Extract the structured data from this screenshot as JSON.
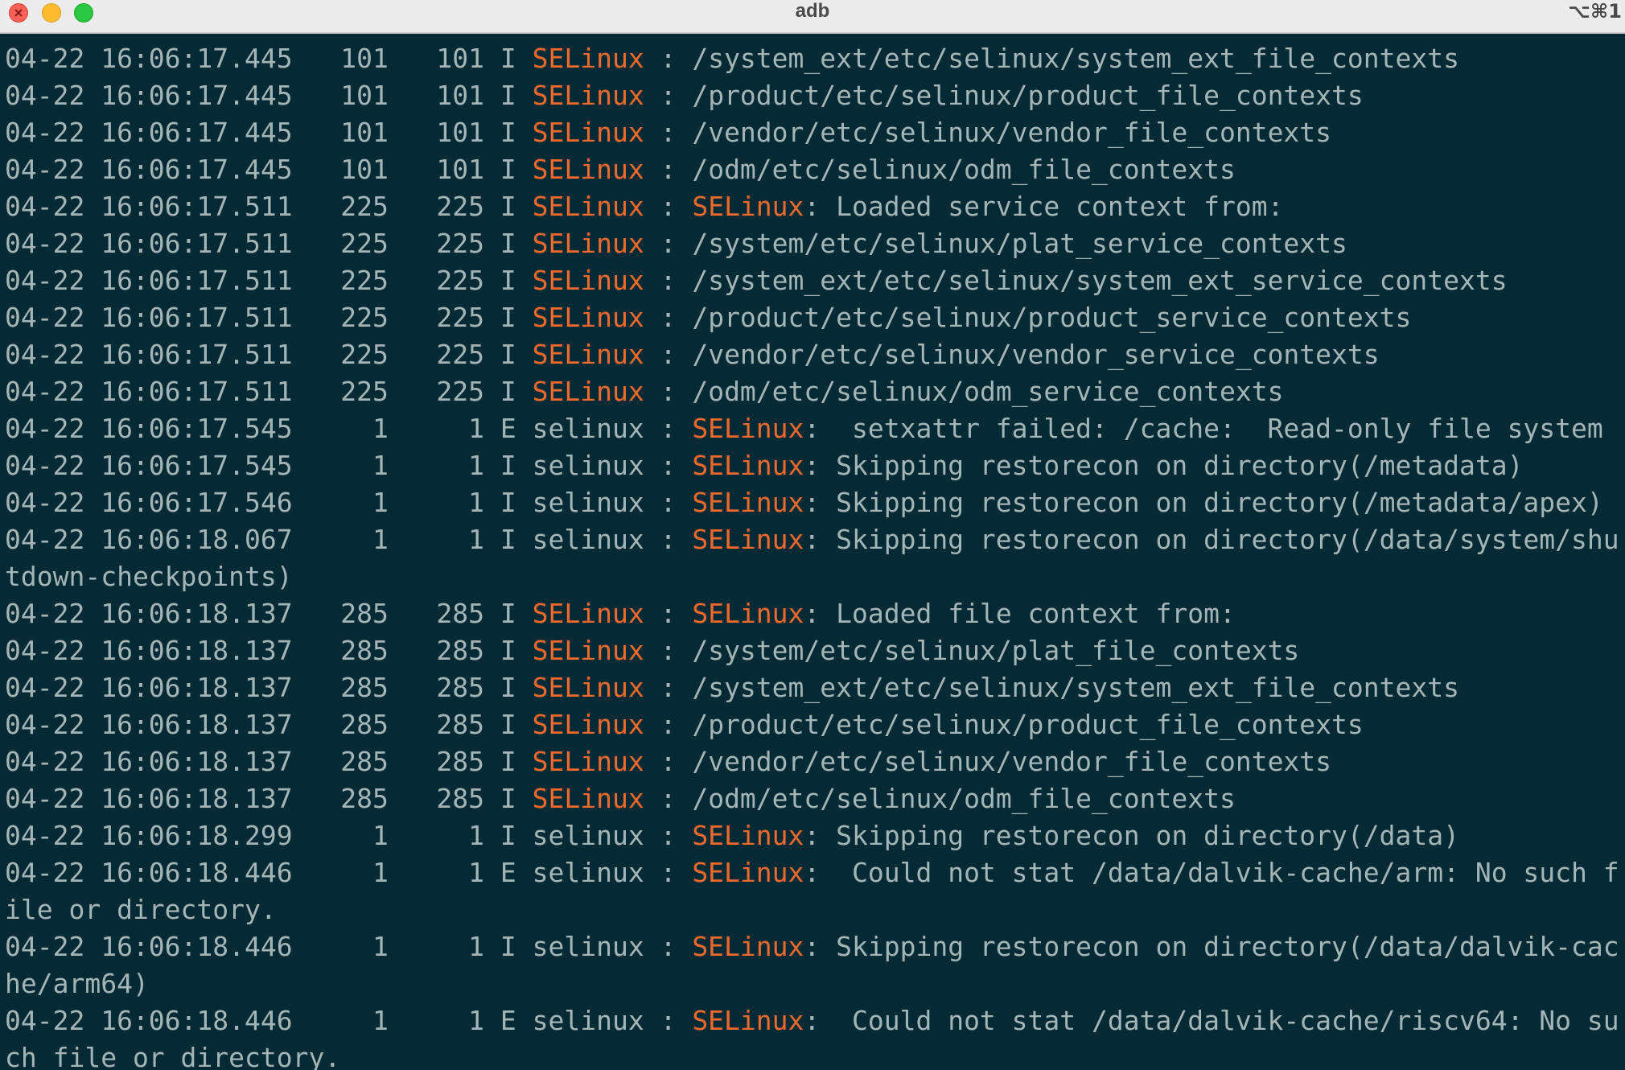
{
  "window": {
    "title": "adb",
    "shortcut": "⌥⌘1",
    "controls": {
      "close_glyph": "×"
    }
  },
  "colors": {
    "background": "#042b35",
    "text": "#a4b5b7",
    "highlight": "#ee6a2c",
    "titlebar": "#ececec"
  },
  "log_lines": [
    {
      "text": "04-22 16:06:17.445   101   101 I ",
      "tag": "SELinux",
      "rest_pre": " : ",
      "ctx": "",
      "rest": "/system_ext/etc/selinux/system_ext_file_contexts"
    },
    {
      "text": "04-22 16:06:17.445   101   101 I ",
      "tag": "SELinux",
      "rest_pre": " : ",
      "ctx": "",
      "rest": "/product/etc/selinux/product_file_contexts"
    },
    {
      "text": "04-22 16:06:17.445   101   101 I ",
      "tag": "SELinux",
      "rest_pre": " : ",
      "ctx": "",
      "rest": "/vendor/etc/selinux/vendor_file_contexts"
    },
    {
      "text": "04-22 16:06:17.445   101   101 I ",
      "tag": "SELinux",
      "rest_pre": " : ",
      "ctx": "",
      "rest": "/odm/etc/selinux/odm_file_contexts"
    },
    {
      "text": "04-22 16:06:17.511   225   225 I ",
      "tag": "SELinux",
      "rest_pre": " : ",
      "ctx": "SELinux",
      "rest": ": Loaded service context from:"
    },
    {
      "text": "04-22 16:06:17.511   225   225 I ",
      "tag": "SELinux",
      "rest_pre": " : ",
      "ctx": "",
      "rest": "/system/etc/selinux/plat_service_contexts"
    },
    {
      "text": "04-22 16:06:17.511   225   225 I ",
      "tag": "SELinux",
      "rest_pre": " : ",
      "ctx": "",
      "rest": "/system_ext/etc/selinux/system_ext_service_contexts"
    },
    {
      "text": "04-22 16:06:17.511   225   225 I ",
      "tag": "SELinux",
      "rest_pre": " : ",
      "ctx": "",
      "rest": "/product/etc/selinux/product_service_contexts"
    },
    {
      "text": "04-22 16:06:17.511   225   225 I ",
      "tag": "SELinux",
      "rest_pre": " : ",
      "ctx": "",
      "rest": "/vendor/etc/selinux/vendor_service_contexts"
    },
    {
      "text": "04-22 16:06:17.511   225   225 I ",
      "tag": "SELinux",
      "rest_pre": " : ",
      "ctx": "",
      "rest": "/odm/etc/selinux/odm_service_contexts"
    },
    {
      "text": "04-22 16:06:17.545     1     1 E selinux : ",
      "tag": "",
      "rest_pre": "",
      "ctx": "SELinux",
      "rest": ":  setxattr failed: /cache:  Read-only file system"
    },
    {
      "text": "04-22 16:06:17.545     1     1 I selinux : ",
      "tag": "",
      "rest_pre": "",
      "ctx": "SELinux",
      "rest": ": Skipping restorecon on directory(/metadata)"
    },
    {
      "text": "04-22 16:06:17.546     1     1 I selinux : ",
      "tag": "",
      "rest_pre": "",
      "ctx": "SELinux",
      "rest": ": Skipping restorecon on directory(/metadata/apex)"
    },
    {
      "text": "04-22 16:06:18.067     1     1 I selinux : ",
      "tag": "",
      "rest_pre": "",
      "ctx": "SELinux",
      "rest": ": Skipping restorecon on directory(/data/system/shu"
    },
    {
      "text": "tdown-checkpoints)",
      "tag": "",
      "rest_pre": "",
      "ctx": "",
      "rest": ""
    },
    {
      "text": "04-22 16:06:18.137   285   285 I ",
      "tag": "SELinux",
      "rest_pre": " : ",
      "ctx": "SELinux",
      "rest": ": Loaded file context from:"
    },
    {
      "text": "04-22 16:06:18.137   285   285 I ",
      "tag": "SELinux",
      "rest_pre": " : ",
      "ctx": "",
      "rest": "/system/etc/selinux/plat_file_contexts"
    },
    {
      "text": "04-22 16:06:18.137   285   285 I ",
      "tag": "SELinux",
      "rest_pre": " : ",
      "ctx": "",
      "rest": "/system_ext/etc/selinux/system_ext_file_contexts"
    },
    {
      "text": "04-22 16:06:18.137   285   285 I ",
      "tag": "SELinux",
      "rest_pre": " : ",
      "ctx": "",
      "rest": "/product/etc/selinux/product_file_contexts"
    },
    {
      "text": "04-22 16:06:18.137   285   285 I ",
      "tag": "SELinux",
      "rest_pre": " : ",
      "ctx": "",
      "rest": "/vendor/etc/selinux/vendor_file_contexts"
    },
    {
      "text": "04-22 16:06:18.137   285   285 I ",
      "tag": "SELinux",
      "rest_pre": " : ",
      "ctx": "",
      "rest": "/odm/etc/selinux/odm_file_contexts"
    },
    {
      "text": "04-22 16:06:18.299     1     1 I selinux : ",
      "tag": "",
      "rest_pre": "",
      "ctx": "SELinux",
      "rest": ": Skipping restorecon on directory(/data)"
    },
    {
      "text": "04-22 16:06:18.446     1     1 E selinux : ",
      "tag": "",
      "rest_pre": "",
      "ctx": "SELinux",
      "rest": ":  Could not stat /data/dalvik-cache/arm: No such f"
    },
    {
      "text": "ile or directory.",
      "tag": "",
      "rest_pre": "",
      "ctx": "",
      "rest": ""
    },
    {
      "text": "04-22 16:06:18.446     1     1 I selinux : ",
      "tag": "",
      "rest_pre": "",
      "ctx": "SELinux",
      "rest": ": Skipping restorecon on directory(/data/dalvik-cac"
    },
    {
      "text": "he/arm64)",
      "tag": "",
      "rest_pre": "",
      "ctx": "",
      "rest": ""
    },
    {
      "text": "04-22 16:06:18.446     1     1 E selinux : ",
      "tag": "",
      "rest_pre": "",
      "ctx": "SELinux",
      "rest": ":  Could not stat /data/dalvik-cache/riscv64: No su"
    },
    {
      "text": "ch file or directory.",
      "tag": "",
      "rest_pre": "",
      "ctx": "",
      "rest": ""
    }
  ]
}
